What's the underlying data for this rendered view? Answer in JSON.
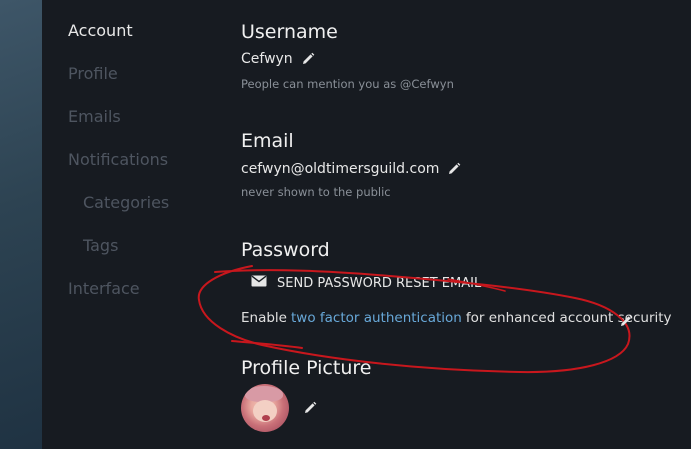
{
  "sidebar": {
    "items": [
      {
        "label": "Account",
        "active": true
      },
      {
        "label": "Profile"
      },
      {
        "label": "Emails"
      },
      {
        "label": "Notifications"
      },
      {
        "label": "Categories",
        "sub": true
      },
      {
        "label": "Tags",
        "sub": true
      },
      {
        "label": "Interface"
      }
    ]
  },
  "username": {
    "title": "Username",
    "value": "Cefwyn",
    "hint": "People can mention you as @Cefwyn"
  },
  "email": {
    "title": "Email",
    "value": "cefwyn@oldtimersguild.com",
    "hint": "never shown to the public"
  },
  "password": {
    "title": "Password",
    "reset_label": "SEND PASSWORD RESET EMAIL",
    "twofa_prefix": "Enable",
    "twofa_link": "two factor authentication",
    "twofa_suffix": "for enhanced account security"
  },
  "profile_picture": {
    "title": "Profile Picture"
  },
  "colors": {
    "background": "#171b21",
    "link": "#68a8d8",
    "annotation": "#c8171d"
  },
  "icons": [
    "pencil-icon",
    "envelope-icon"
  ]
}
